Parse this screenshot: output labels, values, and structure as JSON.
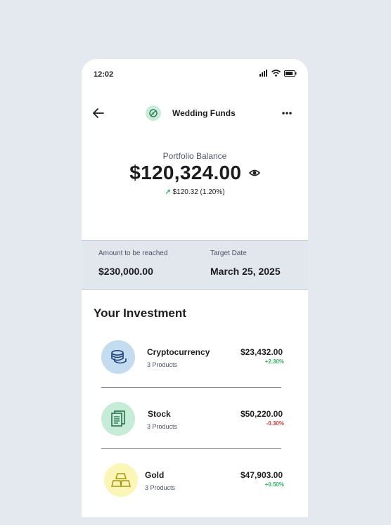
{
  "status_bar": {
    "time": "12:02"
  },
  "header": {
    "title": "Wedding Funds"
  },
  "portfolio": {
    "label": "Portfolio Balance",
    "amount": "$120,324.00",
    "change": "$120.32 (1.20%)",
    "change_color": "#2fb461"
  },
  "target": {
    "amount_label": "Amount to be reached",
    "amount_value": "$230,000.00",
    "date_label": "Target Date",
    "date_value": "March 25, 2025"
  },
  "investments": {
    "title": "Your Investment",
    "items": [
      {
        "name": "Cryptocurrency",
        "products": "3 Products",
        "amount": "$23,432.00",
        "change": "+2.30%",
        "icon": "coins-icon",
        "circle_color": "#c4dcf0",
        "change_color": "#2fb461"
      },
      {
        "name": "Stock",
        "products": "3 Products",
        "amount": "$50,220.00",
        "change": "-0.30%",
        "icon": "document-stack-icon",
        "circle_color": "#c6ebd7",
        "change_color": "#d63a3a"
      },
      {
        "name": "Gold",
        "products": "3 Products",
        "amount": "$47,903.00",
        "change": "+0.50%",
        "icon": "gold-bars-icon",
        "circle_color": "#fbf6b7",
        "change_color": "#2fb461"
      }
    ]
  }
}
